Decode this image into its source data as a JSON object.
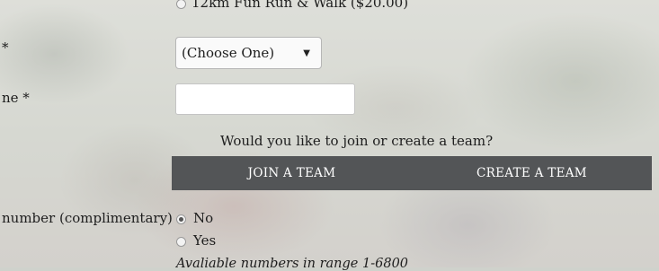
{
  "race_option": {
    "label": "12km Fun Run & Walk ($20.00)"
  },
  "left_labels": {
    "row1": "*",
    "row2": "ne *",
    "row3": "number (complimentary)"
  },
  "dropdown": {
    "selected": "(Choose One)"
  },
  "team": {
    "question": "Would you like to join or create a team?",
    "join_label": "JOIN A TEAM",
    "create_label": "CREATE A TEAM"
  },
  "bib_number": {
    "options": [
      {
        "label": "No",
        "checked": true
      },
      {
        "label": "Yes",
        "checked": false
      }
    ],
    "hint": "Avaliable numbers in range 1-6800"
  },
  "icons": {
    "dropdown_arrow": "caret-down-icon"
  }
}
